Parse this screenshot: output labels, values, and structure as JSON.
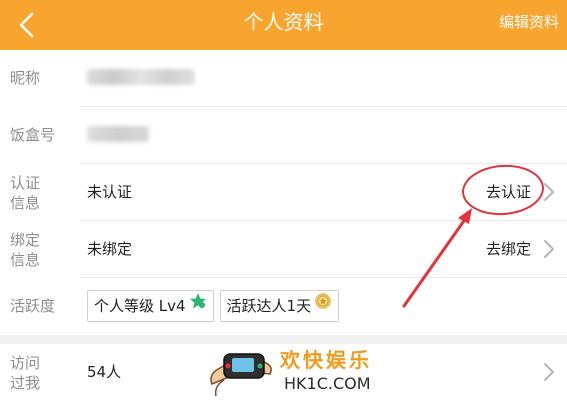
{
  "header": {
    "title": "个人资料",
    "edit_label": "编辑资料"
  },
  "rows": {
    "nickname": {
      "label": "昵称"
    },
    "fanhe_id": {
      "label": "饭盒号"
    },
    "verify": {
      "label": "认证信息",
      "value": "未认证",
      "action": "去认证"
    },
    "bind": {
      "label": "绑定信息",
      "value": "未绑定",
      "action": "去绑定"
    },
    "activity": {
      "label": "活跃度",
      "badges": [
        "个人等级 Lv4",
        "活跃达人1天"
      ]
    },
    "visitors": {
      "label": "访问过我",
      "value": "54人"
    }
  },
  "watermark": {
    "text": "欢快娱乐",
    "url": "HK1C.COM"
  },
  "colors": {
    "header_bg": "#f7a52e",
    "annotation": "#e53238",
    "watermark": "#f29a1c"
  },
  "icons": {
    "back": "chevron-left-icon",
    "row_chevron": "chevron-right-icon",
    "lv_star": "star-icon",
    "medal": "medal-icon"
  }
}
